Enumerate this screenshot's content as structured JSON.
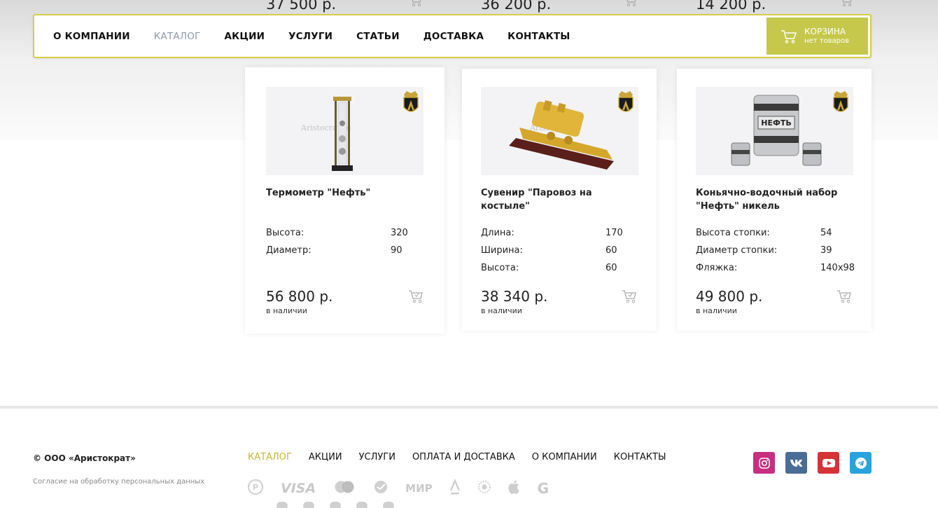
{
  "previous_row": {
    "prices": [
      "37 500 р.",
      "36 200 р.",
      "14 200 р."
    ]
  },
  "nav": {
    "items": [
      "О КОМПАНИИ",
      "КАТАЛОГ",
      "АКЦИИ",
      "УСЛУГИ",
      "СТАТЬИ",
      "ДОСТАВКА",
      "КОНТАКТЫ"
    ],
    "active": "КАТАЛОГ",
    "cart": {
      "title": "КОРЗИНА",
      "subtitle": "нет товаров"
    }
  },
  "products": [
    {
      "title": "Термометр \"Нефть\"",
      "watermark": "Aristocrat.ru",
      "specs": [
        {
          "name": "Высота:",
          "value": "320"
        },
        {
          "name": "Диаметр:",
          "value": "90"
        }
      ],
      "price": "56 800 р.",
      "stock": "в наличии"
    },
    {
      "title": "Сувенир \"Паровоз на костыле\"",
      "watermark": "Aristocrat.ru",
      "specs": [
        {
          "name": "Длина:",
          "value": "170"
        },
        {
          "name": "Ширина:",
          "value": "60"
        },
        {
          "name": "Высота:",
          "value": "60"
        }
      ],
      "price": "38 340 р.",
      "stock": "в наличии"
    },
    {
      "title": "Коньячно-водочный набор \"Нефть\" никель",
      "watermark": "НЕФТЬ",
      "specs": [
        {
          "name": "Высота стопки:",
          "value": "54"
        },
        {
          "name": "Диаметр стопки:",
          "value": "39"
        },
        {
          "name": "Фляжка:",
          "value": "140x98"
        }
      ],
      "price": "49 800 р.",
      "stock": "в наличии"
    }
  ],
  "footer": {
    "copyright": "© ООО «Аристократ»",
    "consent": "Согласие на обработку персональных данных",
    "nav": [
      "КАТАЛОГ",
      "АКЦИИ",
      "УСЛУГИ",
      "ОПЛАТА И ДОСТАВКА",
      "О КОМПАНИИ",
      "КОНТАКТЫ"
    ],
    "nav_active": "КАТАЛОГ",
    "payments": [
      "VISA",
      "МИР",
      "G"
    ],
    "socials": [
      {
        "name": "instagram-icon",
        "color": "#c5307f"
      },
      {
        "name": "vk-icon",
        "color": "#4a6d96"
      },
      {
        "name": "youtube-icon",
        "color": "#d63237"
      },
      {
        "name": "telegram-icon",
        "color": "#2aa3dd"
      }
    ]
  },
  "colors": {
    "accent": "#c5c84b",
    "nav_border": "#d8cc48",
    "active_nav": "#8c9aa7",
    "footer_active": "#c8b535"
  }
}
